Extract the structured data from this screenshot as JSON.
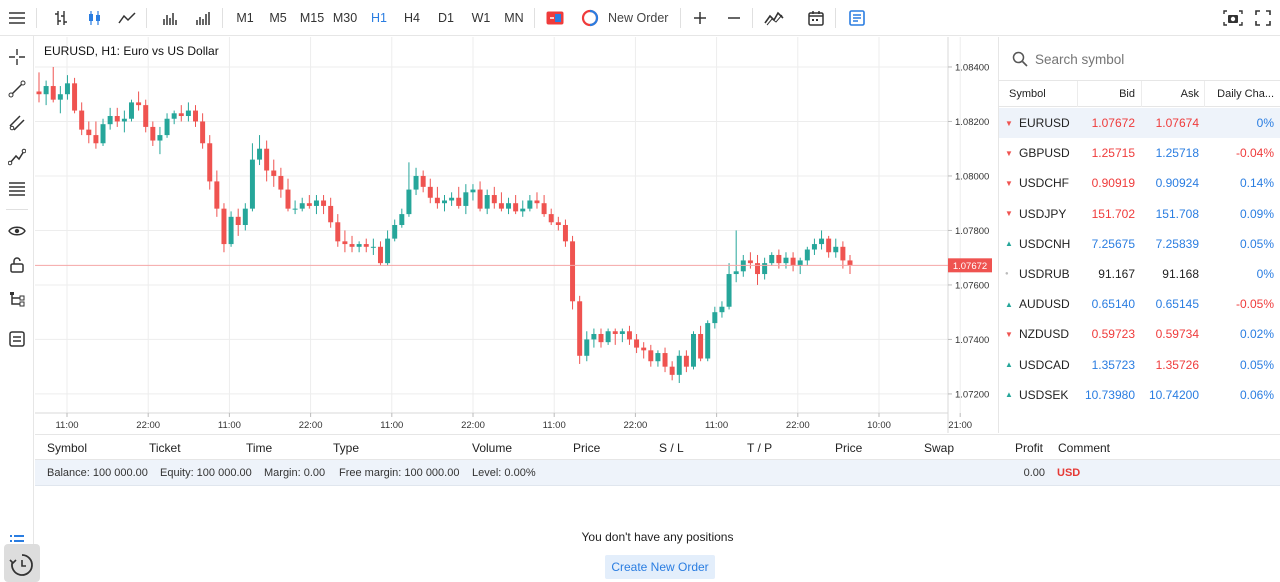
{
  "toolbar": {
    "timeframes": [
      "M1",
      "M5",
      "M15",
      "M30",
      "H1",
      "H4",
      "D1",
      "W1",
      "MN"
    ],
    "active_timeframe": "H1",
    "new_order_label": "New Order"
  },
  "chart": {
    "title": "EURUSD, H1: Euro vs US Dollar",
    "price_ticks": [
      "1.08400",
      "1.08200",
      "1.08000",
      "1.07800",
      "1.07600",
      "1.07400",
      "1.07200"
    ],
    "time_ticks": [
      "11:00",
      "22:00",
      "11:00",
      "22:00",
      "11:00",
      "22:00",
      "11:00",
      "22:00",
      "11:00",
      "22:00",
      "10:00",
      "21:00"
    ],
    "current_price": "1.07672",
    "colors": {
      "up": "#26a69a",
      "down": "#ef5350",
      "price_line": "#f4a6a6"
    }
  },
  "chart_data": {
    "type": "candlestick",
    "symbol": "EURUSD",
    "timeframe": "H1",
    "ylim": [
      1.0713,
      1.0851
    ],
    "ohlc": [
      [
        1.0831,
        1.0838,
        1.0827,
        1.083
      ],
      [
        1.083,
        1.0835,
        1.0826,
        1.0833
      ],
      [
        1.0833,
        1.084,
        1.0827,
        1.0828
      ],
      [
        1.0828,
        1.0833,
        1.0823,
        1.083
      ],
      [
        1.083,
        1.0837,
        1.0828,
        1.0834
      ],
      [
        1.0834,
        1.0836,
        1.0823,
        1.0824
      ],
      [
        1.0824,
        1.0827,
        1.0815,
        1.0817
      ],
      [
        1.0817,
        1.082,
        1.0812,
        1.0815
      ],
      [
        1.0815,
        1.082,
        1.081,
        1.0812
      ],
      [
        1.0812,
        1.0821,
        1.0811,
        1.0819
      ],
      [
        1.0819,
        1.0825,
        1.0817,
        1.0822
      ],
      [
        1.0822,
        1.0825,
        1.0818,
        1.082
      ],
      [
        1.082,
        1.0824,
        1.0816,
        1.0821
      ],
      [
        1.0821,
        1.0828,
        1.082,
        1.0827
      ],
      [
        1.0827,
        1.0831,
        1.0824,
        1.0826
      ],
      [
        1.0826,
        1.0828,
        1.0816,
        1.0818
      ],
      [
        1.0818,
        1.082,
        1.0811,
        1.0813
      ],
      [
        1.0813,
        1.0818,
        1.0808,
        1.0815
      ],
      [
        1.0815,
        1.0823,
        1.0814,
        1.0821
      ],
      [
        1.0821,
        1.0824,
        1.0819,
        1.0823
      ],
      [
        1.0823,
        1.0826,
        1.082,
        1.0822
      ],
      [
        1.0822,
        1.0827,
        1.082,
        1.0824
      ],
      [
        1.0824,
        1.0826,
        1.0818,
        1.082
      ],
      [
        1.082,
        1.0823,
        1.081,
        1.0812
      ],
      [
        1.0812,
        1.0815,
        1.0795,
        1.0798
      ],
      [
        1.0798,
        1.0802,
        1.0785,
        1.0788
      ],
      [
        1.0788,
        1.079,
        1.0772,
        1.0775
      ],
      [
        1.0775,
        1.0787,
        1.0774,
        1.0785
      ],
      [
        1.0785,
        1.0788,
        1.0778,
        1.0782
      ],
      [
        1.0782,
        1.079,
        1.078,
        1.0788
      ],
      [
        1.0788,
        1.0812,
        1.0787,
        1.0806
      ],
      [
        1.0806,
        1.0815,
        1.0804,
        1.081
      ],
      [
        1.081,
        1.0813,
        1.0798,
        1.0802
      ],
      [
        1.0802,
        1.0806,
        1.0796,
        1.08
      ],
      [
        1.08,
        1.0803,
        1.0792,
        1.0795
      ],
      [
        1.0795,
        1.0799,
        1.0787,
        1.0788
      ],
      [
        1.0788,
        1.0791,
        1.0786,
        1.0788
      ],
      [
        1.0788,
        1.0792,
        1.0787,
        1.079
      ],
      [
        1.079,
        1.0793,
        1.0788,
        1.0789
      ],
      [
        1.0789,
        1.0793,
        1.0786,
        1.0791
      ],
      [
        1.0791,
        1.0793,
        1.0786,
        1.0789
      ],
      [
        1.0789,
        1.0792,
        1.0781,
        1.0783
      ],
      [
        1.0783,
        1.0786,
        1.0774,
        1.0776
      ],
      [
        1.0776,
        1.078,
        1.0772,
        1.0775
      ],
      [
        1.0775,
        1.0778,
        1.0772,
        1.0774
      ],
      [
        1.0774,
        1.0776,
        1.0772,
        1.0775
      ],
      [
        1.0775,
        1.0777,
        1.0772,
        1.0774
      ],
      [
        1.0774,
        1.0777,
        1.0771,
        1.0774
      ],
      [
        1.0774,
        1.0776,
        1.0767,
        1.0768
      ],
      [
        1.0768,
        1.078,
        1.0767,
        1.0777
      ],
      [
        1.0777,
        1.0784,
        1.0776,
        1.0782
      ],
      [
        1.0782,
        1.0788,
        1.0781,
        1.0786
      ],
      [
        1.0786,
        1.0805,
        1.0785,
        1.0795
      ],
      [
        1.0795,
        1.0803,
        1.0793,
        1.08
      ],
      [
        1.08,
        1.0802,
        1.0794,
        1.0796
      ],
      [
        1.0796,
        1.0799,
        1.079,
        1.0792
      ],
      [
        1.0792,
        1.0796,
        1.0788,
        1.079
      ],
      [
        1.079,
        1.0793,
        1.0787,
        1.0791
      ],
      [
        1.0791,
        1.0794,
        1.0789,
        1.0792
      ],
      [
        1.0792,
        1.0796,
        1.0788,
        1.0789
      ],
      [
        1.0789,
        1.0797,
        1.0786,
        1.0794
      ],
      [
        1.0794,
        1.0797,
        1.0791,
        1.0795
      ],
      [
        1.0795,
        1.0798,
        1.0787,
        1.0788
      ],
      [
        1.0788,
        1.0795,
        1.0786,
        1.0793
      ],
      [
        1.0793,
        1.0796,
        1.0788,
        1.079
      ],
      [
        1.079,
        1.0794,
        1.0787,
        1.0788
      ],
      [
        1.0788,
        1.0792,
        1.0786,
        1.079
      ],
      [
        1.079,
        1.0793,
        1.0786,
        1.0787
      ],
      [
        1.0787,
        1.0791,
        1.0785,
        1.0788
      ],
      [
        1.0788,
        1.0793,
        1.0787,
        1.0791
      ],
      [
        1.0791,
        1.0794,
        1.0788,
        1.079
      ],
      [
        1.079,
        1.0793,
        1.0785,
        1.0786
      ],
      [
        1.0786,
        1.0788,
        1.0782,
        1.0783
      ],
      [
        1.0783,
        1.0785,
        1.078,
        1.0782
      ],
      [
        1.0782,
        1.0784,
        1.0774,
        1.0776
      ],
      [
        1.0776,
        1.0778,
        1.0751,
        1.0754
      ],
      [
        1.0754,
        1.0756,
        1.0731,
        1.0734
      ],
      [
        1.0734,
        1.0743,
        1.0732,
        1.074
      ],
      [
        1.074,
        1.0744,
        1.0737,
        1.0742
      ],
      [
        1.0742,
        1.0744,
        1.0737,
        1.0739
      ],
      [
        1.0739,
        1.0744,
        1.0738,
        1.0743
      ],
      [
        1.0743,
        1.0744,
        1.0738,
        1.0742
      ],
      [
        1.0742,
        1.0744,
        1.0739,
        1.0743
      ],
      [
        1.0743,
        1.0745,
        1.0738,
        1.074
      ],
      [
        1.074,
        1.0742,
        1.0735,
        1.0737
      ],
      [
        1.0737,
        1.0739,
        1.0733,
        1.0736
      ],
      [
        1.0736,
        1.0738,
        1.073,
        1.0732
      ],
      [
        1.0732,
        1.0736,
        1.073,
        1.0735
      ],
      [
        1.0735,
        1.0737,
        1.0728,
        1.073
      ],
      [
        1.073,
        1.0732,
        1.0725,
        1.0727
      ],
      [
        1.0727,
        1.0736,
        1.0724,
        1.0734
      ],
      [
        1.0734,
        1.0736,
        1.0728,
        1.073
      ],
      [
        1.073,
        1.0743,
        1.0729,
        1.0742
      ],
      [
        1.0742,
        1.0745,
        1.0732,
        1.0733
      ],
      [
        1.0733,
        1.0747,
        1.0732,
        1.0746
      ],
      [
        1.0746,
        1.0752,
        1.0744,
        1.075
      ],
      [
        1.075,
        1.0754,
        1.0748,
        1.0752
      ],
      [
        1.0752,
        1.0768,
        1.0751,
        1.0764
      ],
      [
        1.0764,
        1.078,
        1.0761,
        1.0765
      ],
      [
        1.0765,
        1.0771,
        1.0763,
        1.0769
      ],
      [
        1.0769,
        1.0772,
        1.0766,
        1.0768
      ],
      [
        1.0768,
        1.0771,
        1.076,
        1.0764
      ],
      [
        1.0764,
        1.077,
        1.0762,
        1.0768
      ],
      [
        1.0768,
        1.0772,
        1.0767,
        1.0771
      ],
      [
        1.0771,
        1.0773,
        1.0766,
        1.0768
      ],
      [
        1.0768,
        1.0772,
        1.0766,
        1.077
      ],
      [
        1.077,
        1.0772,
        1.0765,
        1.0767
      ],
      [
        1.0767,
        1.077,
        1.0764,
        1.0769
      ],
      [
        1.0769,
        1.0774,
        1.0767,
        1.0773
      ],
      [
        1.0773,
        1.0777,
        1.0771,
        1.0775
      ],
      [
        1.0775,
        1.078,
        1.0773,
        1.0777
      ],
      [
        1.0777,
        1.0778,
        1.077,
        1.0772
      ],
      [
        1.0772,
        1.0777,
        1.077,
        1.0774
      ],
      [
        1.0774,
        1.0776,
        1.0766,
        1.0769
      ],
      [
        1.0769,
        1.0771,
        1.0764,
        1.07672
      ]
    ]
  },
  "orders": {
    "columns": [
      "Symbol",
      "Ticket",
      "Time",
      "Type",
      "Volume",
      "Price",
      "S / L",
      "T / P",
      "Price",
      "Swap",
      "Profit",
      "Comment"
    ],
    "balance_parts": [
      "Balance: 100 000.00",
      "Equity: 100 000.00",
      "Margin: 0.00",
      "Free margin: 100 000.00",
      "Level: 0.00%"
    ],
    "total_profit": "0.00",
    "currency": "USD",
    "empty_message": "You don't have any positions",
    "create_button": "Create New Order"
  },
  "watchlist": {
    "search_placeholder": "Search symbol",
    "columns": [
      "Symbol",
      "Bid",
      "Ask",
      "Daily Cha..."
    ],
    "rows": [
      {
        "symbol": "EURUSD",
        "bid": "1.07672",
        "ask": "1.07674",
        "change": "0%",
        "dir": "down",
        "bid_color": "red",
        "ask_color": "red",
        "change_color": "blue"
      },
      {
        "symbol": "GBPUSD",
        "bid": "1.25715",
        "ask": "1.25718",
        "change": "-0.04%",
        "dir": "down",
        "bid_color": "red",
        "ask_color": "blue",
        "change_color": "red"
      },
      {
        "symbol": "USDCHF",
        "bid": "0.90919",
        "ask": "0.90924",
        "change": "0.14%",
        "dir": "down",
        "bid_color": "red",
        "ask_color": "blue",
        "change_color": "blue"
      },
      {
        "symbol": "USDJPY",
        "bid": "151.702",
        "ask": "151.708",
        "change": "0.09%",
        "dir": "down",
        "bid_color": "red",
        "ask_color": "blue",
        "change_color": "blue"
      },
      {
        "symbol": "USDCNH",
        "bid": "7.25675",
        "ask": "7.25839",
        "change": "0.05%",
        "dir": "up",
        "bid_color": "blue",
        "ask_color": "blue",
        "change_color": "blue"
      },
      {
        "symbol": "USDRUB",
        "bid": "91.167",
        "ask": "91.168",
        "change": "0%",
        "dir": "flat",
        "bid_color": "black",
        "ask_color": "black",
        "change_color": "blue"
      },
      {
        "symbol": "AUDUSD",
        "bid": "0.65140",
        "ask": "0.65145",
        "change": "-0.05%",
        "dir": "up",
        "bid_color": "blue",
        "ask_color": "blue",
        "change_color": "red"
      },
      {
        "symbol": "NZDUSD",
        "bid": "0.59723",
        "ask": "0.59734",
        "change": "0.02%",
        "dir": "down",
        "bid_color": "red",
        "ask_color": "red",
        "change_color": "blue"
      },
      {
        "symbol": "USDCAD",
        "bid": "1.35723",
        "ask": "1.35726",
        "change": "0.05%",
        "dir": "up",
        "bid_color": "blue",
        "ask_color": "red",
        "change_color": "blue"
      },
      {
        "symbol": "USDSEK",
        "bid": "10.73980",
        "ask": "10.74200",
        "change": "0.06%",
        "dir": "up",
        "bid_color": "blue",
        "ask_color": "blue",
        "change_color": "blue"
      }
    ]
  }
}
